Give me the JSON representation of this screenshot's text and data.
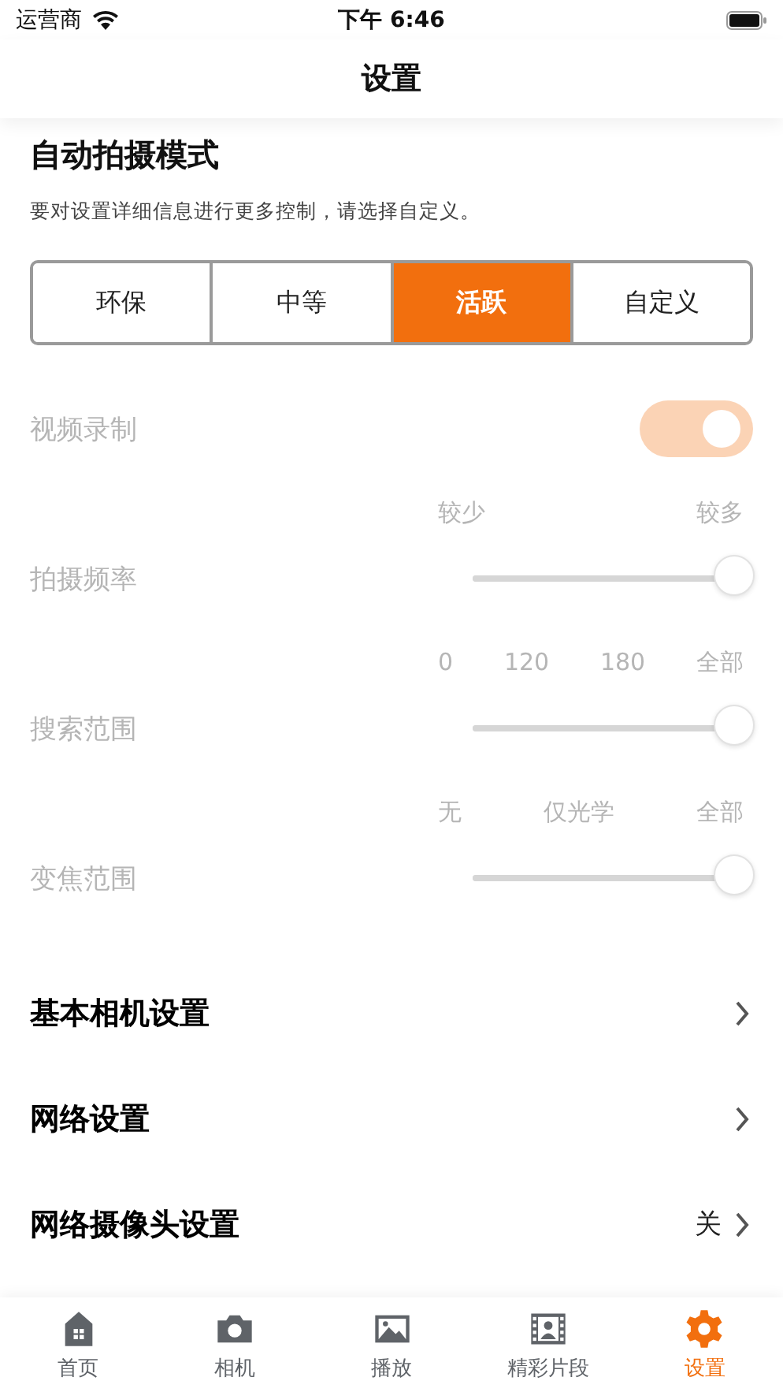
{
  "status_bar": {
    "carrier": "运营商",
    "time": "下午 6:46"
  },
  "nav": {
    "title": "设置"
  },
  "auto_mode": {
    "title": "自动拍摄模式",
    "description": "要对设置详细信息进行更多控制，请选择自定义。",
    "segments": [
      {
        "label": "环保",
        "selected": false
      },
      {
        "label": "中等",
        "selected": false
      },
      {
        "label": "活跃",
        "selected": true
      },
      {
        "label": "自定义",
        "selected": false
      }
    ],
    "controls_disabled": true,
    "toggle": {
      "label": "视频录制",
      "on": true
    },
    "sliders": [
      {
        "label": "拍摄频率",
        "ticks": [
          "较少",
          "较多"
        ],
        "level": 1
      },
      {
        "label": "搜索范围",
        "ticks": [
          "0",
          "120",
          "180",
          "全部"
        ],
        "level": 1
      },
      {
        "label": "变焦范围",
        "ticks": [
          "无",
          "仅光学",
          "全部"
        ],
        "level": 1
      }
    ]
  },
  "menu": [
    {
      "label": "基本相机设置"
    },
    {
      "label": "网络设置"
    },
    {
      "label": "网络摄像头设置",
      "value": "关"
    }
  ],
  "tab_bar": [
    {
      "label": "首页",
      "selected": false
    },
    {
      "label": "相机",
      "selected": false
    },
    {
      "label": "播放",
      "selected": false
    },
    {
      "label": "精彩片段",
      "selected": false
    },
    {
      "label": "设置",
      "selected": true
    }
  ]
}
